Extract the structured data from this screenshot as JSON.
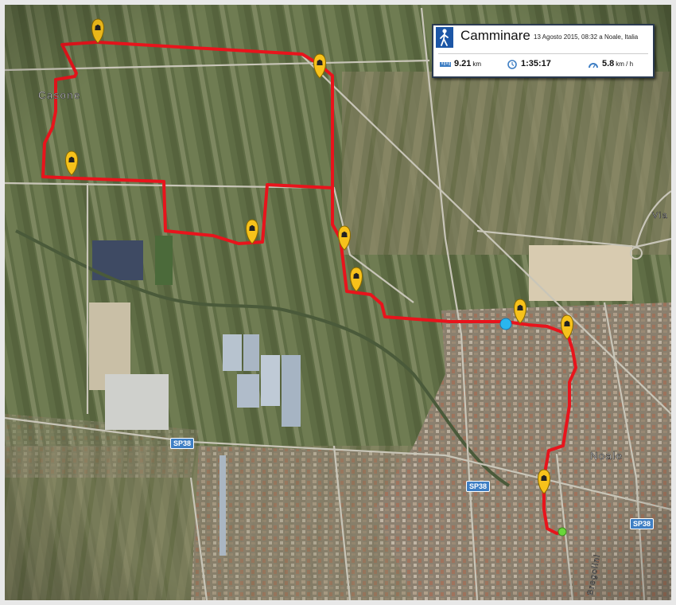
{
  "activity": {
    "title": "Camminare",
    "subtitle": "13 Agosto 2015, 08:32 a Noale, Italia",
    "distance_value": "9.21",
    "distance_unit": "km",
    "duration": "1:35:17",
    "speed_value": "5.8",
    "speed_unit": "km / h",
    "icons": [
      "walking-person-icon",
      "distance-ruler-icon",
      "clock-icon",
      "speedometer-icon"
    ]
  },
  "places": {
    "casone": "Casone",
    "noale": "Noale",
    "via_partial": "Via",
    "bregolini": "Bregolini"
  },
  "roads": {
    "sp38_west": "SP38",
    "sp38_center": "SP38",
    "sp38_east": "SP38"
  },
  "colors": {
    "route": "#e8141c",
    "marker": "#f7c21b",
    "start_point": "#2ab6ee",
    "end_point": "#6ad63a",
    "panel_border": "#2a3a50",
    "road_badge": "#3f7fc4"
  },
  "markers": {
    "type": "walking-photo-marker-icon",
    "count": 9
  }
}
